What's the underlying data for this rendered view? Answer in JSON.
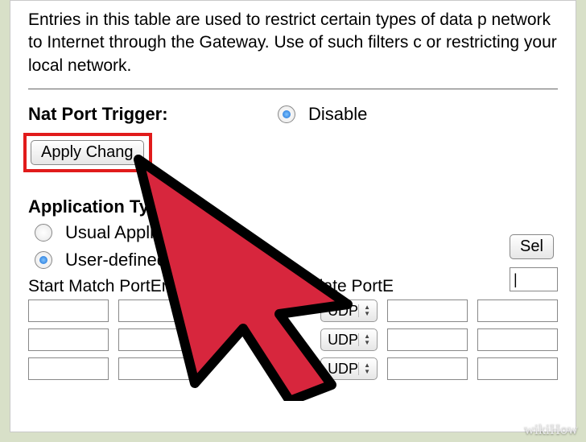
{
  "description": "Entries in this table are used to restrict certain types of data p network to Internet through the Gateway. Use of such filters c or restricting your local network.",
  "natPortTrigger": {
    "label": "Nat Port Trigger:",
    "disableLabel": "Disable"
  },
  "applyChanges": {
    "label": "Apply Chang"
  },
  "applicationType": {
    "heading": "Application Type",
    "usualLabel": "Usual Applicatio",
    "userDefinedLabel": "User-defined Appli"
  },
  "selectButton": {
    "label": "Sel"
  },
  "userDefinedInputValue": "|",
  "tableHeader": "Start Match PortEnd Match                       colStart Relate PortE",
  "protocolOptions": [
    "UDP",
    "UDP",
    "UDP"
  ],
  "watermark": "wikiHow",
  "arrowUp": "▲",
  "arrowDown": "▼"
}
